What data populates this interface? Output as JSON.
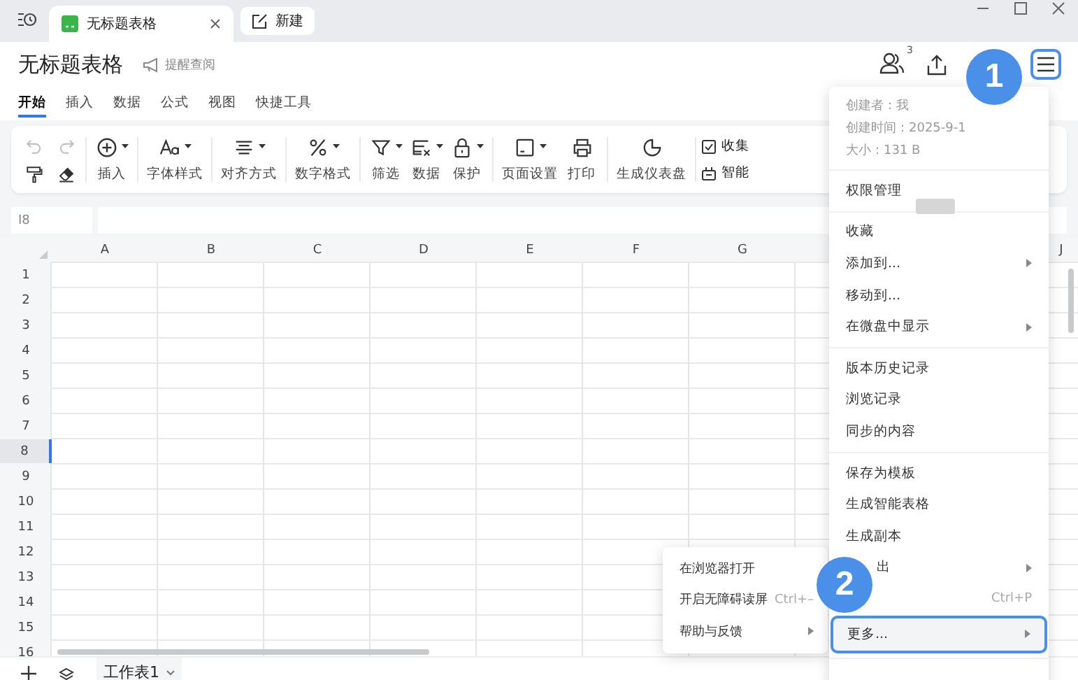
{
  "window": {
    "tabs": [
      {
        "title": "无标题表格",
        "selected": true
      }
    ],
    "new_button": "新建"
  },
  "document": {
    "title": "无标题表格",
    "remind": "提醒查阅",
    "collaborators": "3"
  },
  "ribbon_tabs": [
    {
      "label": "开始",
      "selected": true
    },
    {
      "label": "插入",
      "selected": false
    },
    {
      "label": "数据",
      "selected": false
    },
    {
      "label": "公式",
      "selected": false
    },
    {
      "label": "视图",
      "selected": false
    },
    {
      "label": "快捷工具",
      "selected": false
    }
  ],
  "toolbar": {
    "mini": [
      {
        "disabled": true
      },
      {
        "disabled": true
      },
      {
        "disabled": false
      },
      {
        "disabled": false
      }
    ],
    "groups": [
      [
        {
          "label": "插入",
          "dropdown": true
        }
      ],
      [
        {
          "label": "字体样式",
          "dropdown": true
        }
      ],
      [
        {
          "label": "对齐方式",
          "dropdown": true
        }
      ],
      [
        {
          "label": "数字格式",
          "dropdown": true
        }
      ],
      [
        {
          "label": "筛选",
          "dropdown": true
        },
        {
          "label": "数据",
          "dropdown": true
        },
        {
          "label": "保护",
          "dropdown": true
        }
      ],
      [
        {
          "label": "页面设置",
          "dropdown": true
        },
        {
          "label": "打印",
          "dropdown": false
        }
      ],
      [
        {
          "label": "生成仪表盘",
          "dropdown": false
        }
      ]
    ],
    "side_items": [
      "收集",
      "智能"
    ]
  },
  "formula_bar": {
    "cell": "I8"
  },
  "sheet": {
    "columns": [
      "A",
      "B",
      "C",
      "D",
      "E",
      "F",
      "G"
    ],
    "last_column": "J",
    "rows": [
      {
        "label": "1",
        "selected": false
      },
      {
        "label": "2",
        "selected": false
      },
      {
        "label": "3",
        "selected": false
      },
      {
        "label": "4",
        "selected": false
      },
      {
        "label": "5",
        "selected": false
      },
      {
        "label": "6",
        "selected": false
      },
      {
        "label": "7",
        "selected": false
      },
      {
        "label": "8",
        "selected": true
      },
      {
        "label": "9",
        "selected": false
      },
      {
        "label": "10",
        "selected": false
      },
      {
        "label": "11",
        "selected": false
      },
      {
        "label": "12",
        "selected": false
      },
      {
        "label": "13",
        "selected": false
      },
      {
        "label": "14",
        "selected": false
      },
      {
        "label": "15",
        "selected": false
      },
      {
        "label": "16",
        "selected": false
      }
    ]
  },
  "sheet_tabs": [
    {
      "label": "工作表1",
      "selected": true
    }
  ],
  "menu": {
    "info": [
      "创建者：我",
      "创建时间：2025-9-1",
      "大小：131 B"
    ],
    "sections": [
      [
        {
          "label": "权限管理",
          "submenu": false,
          "selected": false
        }
      ],
      [
        {
          "label": "收藏",
          "submenu": false,
          "selected": false
        },
        {
          "label": "添加到...",
          "submenu": true,
          "selected": false
        },
        {
          "label": "移动到...",
          "submenu": false,
          "selected": false
        },
        {
          "label": "在微盘中显示",
          "submenu": true,
          "selected": false
        }
      ],
      [
        {
          "label": "版本历史记录",
          "submenu": false,
          "selected": false
        },
        {
          "label": "浏览记录",
          "submenu": false,
          "selected": false
        },
        {
          "label": "同步的内容",
          "submenu": false,
          "selected": false
        }
      ],
      [
        {
          "label": "保存为模板",
          "submenu": false,
          "selected": false
        },
        {
          "label": "生成智能表格",
          "submenu": false,
          "selected": false
        },
        {
          "label": "生成副本",
          "submenu": false,
          "selected": false
        },
        {
          "label_tail": "出",
          "submenu": true,
          "selected": false
        },
        {
          "shortcut": "Ctrl+P",
          "submenu": false,
          "selected": false
        },
        {
          "label": "更多...",
          "submenu": true,
          "selected": true
        }
      ]
    ]
  },
  "submenu": [
    {
      "label": "在浏览器打开",
      "submenu": false
    },
    {
      "label": "开启无障碍读屏",
      "shortcut": "Ctrl+–",
      "submenu": false
    },
    {
      "label": "帮助与反馈",
      "submenu": true
    }
  ],
  "badges": [
    "1",
    "2"
  ]
}
